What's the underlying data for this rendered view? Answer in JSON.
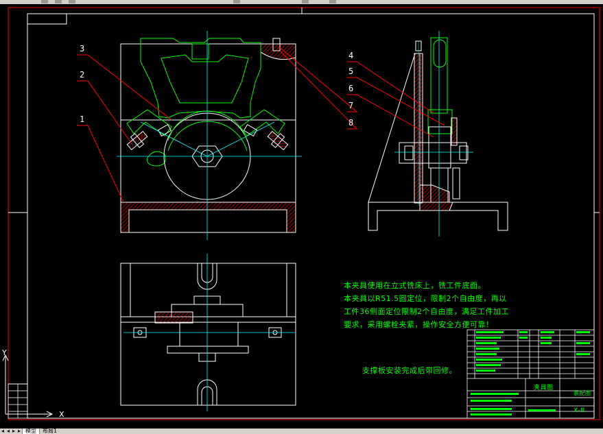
{
  "window": {
    "layout_tabs": [
      "模型",
      "布局1"
    ],
    "active_tab": 0
  },
  "drawing": {
    "leader_labels": [
      "3",
      "2",
      "1",
      "4",
      "5",
      "6",
      "7",
      "8"
    ],
    "notes": [
      "本夹具使用在立式铣床上，铣工件底面。",
      "本夹具以R51.5圆定位，限制2个自由度，再以",
      "工件36侧面定位限制2个自由度，满足工件加工",
      "要求，采用螺栓夹紧，操作安全方便可靠！"
    ],
    "support_note": "支撑板安装完成后带回修。",
    "title_block": {
      "part_name": "夹具图",
      "drawing_no": "X-Ⅲ",
      "mass_label": "装配图"
    },
    "ucs": {
      "x": "X",
      "y": "Y"
    }
  },
  "colors": {
    "background": "#000000",
    "border": "#ffffff",
    "outer_frame": "#ff0000",
    "centerline": "#00ffff",
    "workpiece": "#00ff00",
    "hatch": "#ff0000",
    "note": "#00ff00"
  }
}
